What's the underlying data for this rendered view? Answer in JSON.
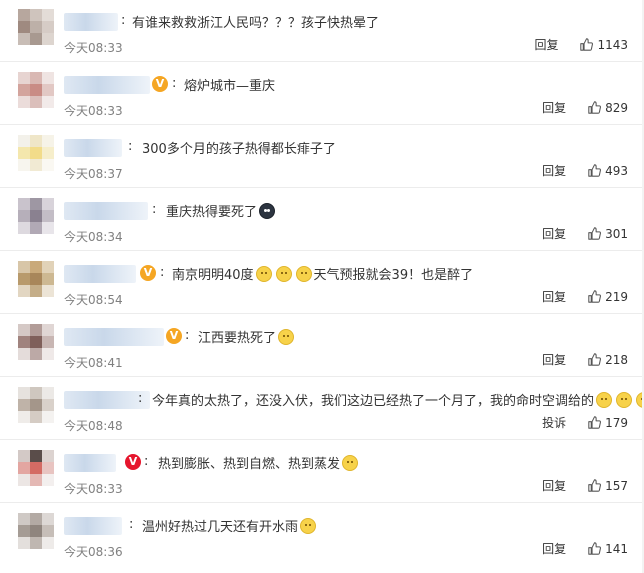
{
  "actions": {
    "reply": "回复",
    "report": "投诉"
  },
  "comments": [
    {
      "text": "有谁来救救浙江人民吗？？？孩子快热晕了",
      "time": "今天08:33",
      "likes": "1143",
      "badge": "",
      "emoji": []
    },
    {
      "text": "熔炉城市—重庆",
      "time": "今天08:33",
      "likes": "829",
      "badge": "V",
      "emoji": []
    },
    {
      "text": "300多个月的孩子热得都长痱子了",
      "time": "今天08:37",
      "likes": "493",
      "badge": "",
      "emoji": []
    },
    {
      "text": "重庆热得要死了",
      "time": "今天08:34",
      "likes": "301",
      "badge": "",
      "emoji": [
        "dark-face-icon"
      ]
    },
    {
      "text": "南京明明40度",
      "text2": "天气预报就会39！也是醉了",
      "time": "今天08:54",
      "likes": "219",
      "badge": "V",
      "emoji": [
        "smile-face-icon",
        "smile-face-icon",
        "smile-face-icon"
      ]
    },
    {
      "text": "江西要热死了",
      "time": "今天08:41",
      "likes": "218",
      "badge": "V",
      "emoji": [
        "crying-face-icon"
      ]
    },
    {
      "text": "今年真的太热了，还没入伏，我们这边已经热了一个月了，我的命时空调给的",
      "time": "今天08:48",
      "likes": "179",
      "badge": "",
      "emoji": [
        "smile-face-icon",
        "smile-face-icon",
        "smile-face-icon"
      ]
    },
    {
      "text": "热到膨胀、热到自燃、热到蒸发",
      "time": "今天08:33",
      "likes": "157",
      "badge": "V",
      "emoji": [
        "crying-face-icon"
      ]
    },
    {
      "text": "温州好热过几天还有开水雨",
      "time": "今天08:36",
      "likes": "141",
      "badge": "",
      "emoji": [
        "smile-face-icon"
      ]
    }
  ]
}
